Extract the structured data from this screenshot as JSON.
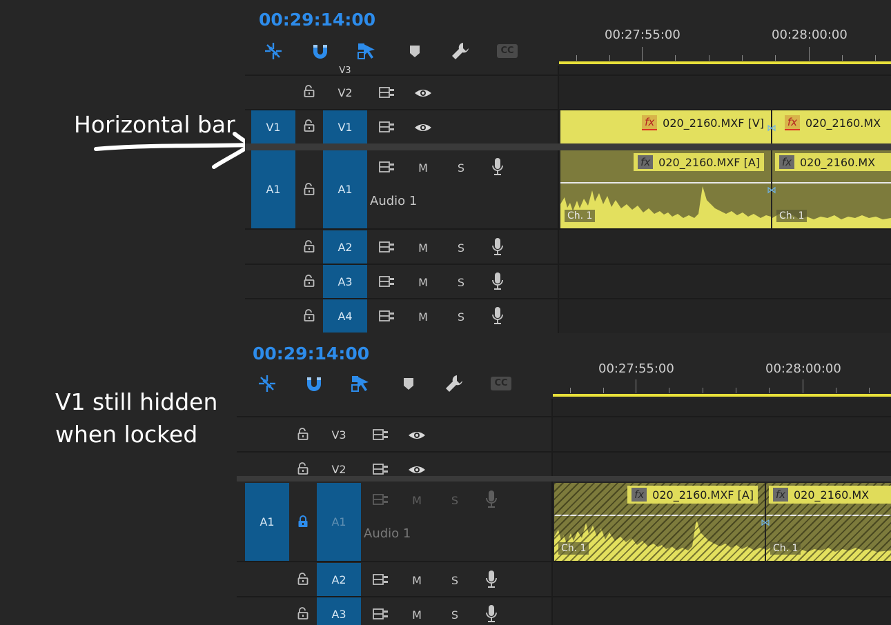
{
  "annotations": {
    "top_note": "Horizontal bar",
    "bottom_note_line1": "V1 still hidden",
    "bottom_note_line2": "when locked"
  },
  "colors": {
    "accent": "#2d8ceb",
    "target": "#0f5a8f",
    "clip_video": "#e3e05e",
    "clip_audio": "#7d7b3c",
    "work_area": "#e8e03a",
    "locked_icon": "#2d8ceb"
  },
  "icons": {
    "tools": [
      "nest-sequence-icon",
      "snap-magnet-icon",
      "linked-selection-icon",
      "add-marker-icon",
      "wrench-settings-icon",
      "captions-cc-icon"
    ],
    "track_lock": "lock-icon",
    "track_output": "film-strip-icon",
    "track_eye": "eye-icon",
    "track_mic": "microphone-icon"
  },
  "top_panel": {
    "timecode": "00:29:14:00",
    "ruler_labels": [
      "00:27:55:00",
      "00:28:00:00"
    ],
    "cc_label": "CC",
    "tracks": {
      "v3": {
        "name": "V3"
      },
      "v2": {
        "name": "V2"
      },
      "v1": {
        "source": "V1",
        "name": "V1"
      },
      "a1": {
        "source": "A1",
        "name": "A1",
        "mute": "M",
        "solo": "S",
        "label": "Audio 1"
      },
      "a2": {
        "name": "A2",
        "mute": "M",
        "solo": "S"
      },
      "a3": {
        "name": "A3",
        "mute": "M",
        "solo": "S"
      },
      "a4": {
        "name": "A4",
        "mute": "M",
        "solo": "S"
      }
    },
    "clips": {
      "video1": "020_2160.MXF [V]",
      "video2": "020_2160.MX",
      "audio1": "020_2160.MXF [A]",
      "audio2": "020_2160.MX",
      "channel": "Ch. 1"
    }
  },
  "bottom_panel": {
    "timecode": "00:29:14:00",
    "ruler_labels": [
      "00:27:55:00",
      "00:28:00:00"
    ],
    "cc_label": "CC",
    "tracks": {
      "v3": {
        "name": "V3"
      },
      "v2": {
        "name": "V2"
      },
      "a1": {
        "source": "A1",
        "name": "A1",
        "mute": "M",
        "solo": "S",
        "label": "Audio 1",
        "locked": true
      },
      "a2": {
        "name": "A2",
        "mute": "M",
        "solo": "S"
      },
      "a3": {
        "name": "A3",
        "mute": "M",
        "solo": "S"
      }
    },
    "clips": {
      "audio1": "020_2160.MXF [A]",
      "audio2": "020_2160.MX",
      "channel": "Ch. 1"
    }
  }
}
